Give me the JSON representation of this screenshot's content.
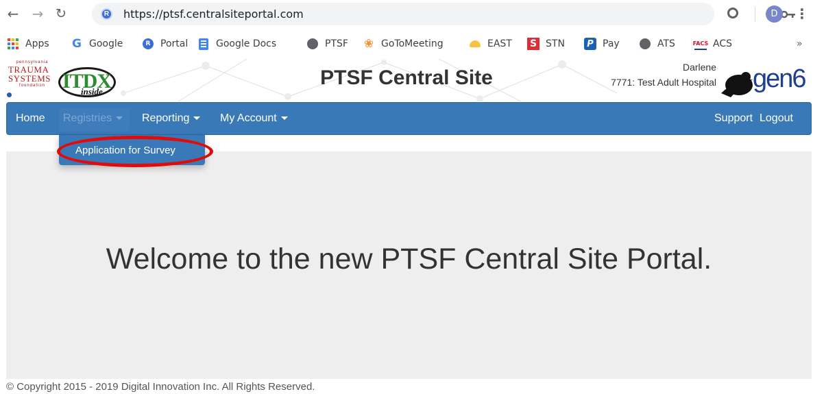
{
  "browser": {
    "url": "https://ptsf.centralsiteportal.com",
    "site_icon_letter": "R",
    "profile_initial": "D",
    "icons": {
      "back": "back-arrow-icon",
      "forward": "forward-arrow-icon",
      "reload": "reload-icon",
      "key": "password-key-icon",
      "extension": "extension-icon",
      "menu": "kebab-menu-icon"
    }
  },
  "bookmarks": [
    {
      "label": "Apps",
      "icon": "apps-grid-icon"
    },
    {
      "label": "Google",
      "icon": "google-icon"
    },
    {
      "label": "Portal",
      "icon": "portal-icon"
    },
    {
      "label": "Google Docs",
      "icon": "google-docs-icon"
    },
    {
      "label": "PTSF",
      "icon": "globe-icon"
    },
    {
      "label": "GoToMeeting",
      "icon": "gotomeeting-icon"
    },
    {
      "label": "EAST",
      "icon": "east-icon"
    },
    {
      "label": "STN",
      "icon": "stn-icon"
    },
    {
      "label": "Pay",
      "icon": "paypal-icon"
    },
    {
      "label": "ATS",
      "icon": "globe-icon"
    },
    {
      "label": "ACS",
      "icon": "facs-icon"
    }
  ],
  "bookmarks_more": "»",
  "header": {
    "title": "PTSF Central Site",
    "user": "Darlene",
    "hospital": "7771: Test Adult Hospital",
    "logo_trauma_top": "pennsylvania",
    "logo_trauma_line1": "TRAUMA",
    "logo_trauma_line2": "SYSTEMS",
    "logo_trauma_line3": "foundation",
    "logo_itdx": "ITDX",
    "logo_itdx_inside": "inside",
    "logo_gen6": "gen6"
  },
  "nav": {
    "items": [
      {
        "label": "Home",
        "dropdown": false
      },
      {
        "label": "Registries",
        "dropdown": true,
        "open": true
      },
      {
        "label": "Reporting",
        "dropdown": true
      },
      {
        "label": "My Account",
        "dropdown": true
      }
    ],
    "right": [
      {
        "label": "Support"
      },
      {
        "label": "Logout"
      }
    ]
  },
  "dropdown": {
    "items": [
      {
        "label": "Application for Survey"
      }
    ]
  },
  "main": {
    "welcome": "Welcome to the new PTSF Central Site Portal."
  },
  "footer": {
    "copyright": "© Copyright 2015 - 2019 Digital Innovation Inc. All Rights Reserved."
  },
  "colors": {
    "navbar": "#3a79b8",
    "highlight": "#e00c0c",
    "main_bg": "#eeeeee"
  }
}
